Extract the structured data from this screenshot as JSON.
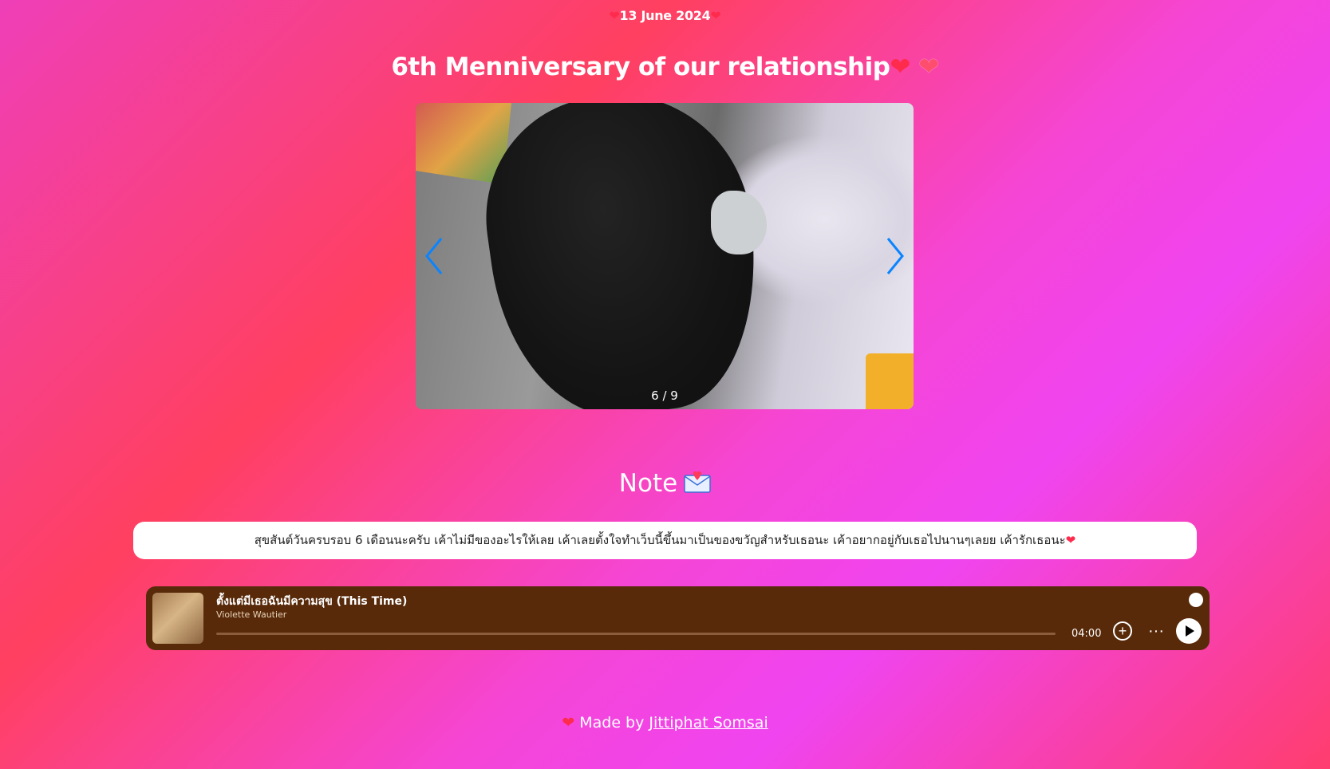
{
  "header": {
    "date_icon": "sparkling-heart-icon",
    "date": "13 June 2024",
    "title": "6th Menniversary of our relationship",
    "title_icons": [
      "sparkling-heart-icon",
      "heart-outline-icon"
    ]
  },
  "carousel": {
    "counter": "6 / 9",
    "current": 6,
    "total": 9,
    "nav_color": "#0a84ff"
  },
  "note": {
    "heading": "Note",
    "heading_icon": "love-letter-icon",
    "text": "สุขสันต์วันครบรอบ 6 เดือนนะครับ เค้าไม่มีของอะไรให้เลย เค้าเลยตั้งใจทำเว็บนี้ขึ้นมาเป็นของขวัญสำหรับเธอนะ เค้าอยากอยู่กับเธอไปนานๆเลยย เค้ารักเธอนะ",
    "end_icon": "sparkling-heart-icon"
  },
  "player": {
    "track_title": "ตั้งแต่มีเธอฉันมีความสุข (This Time)",
    "artist": "Violette Wautier",
    "duration": "04:00",
    "progress": 0,
    "background": "#582a0a",
    "add_symbol": "+",
    "more_symbol": "···"
  },
  "footer": {
    "prefix": "Made by",
    "author": "Jittiphat Somsai"
  }
}
